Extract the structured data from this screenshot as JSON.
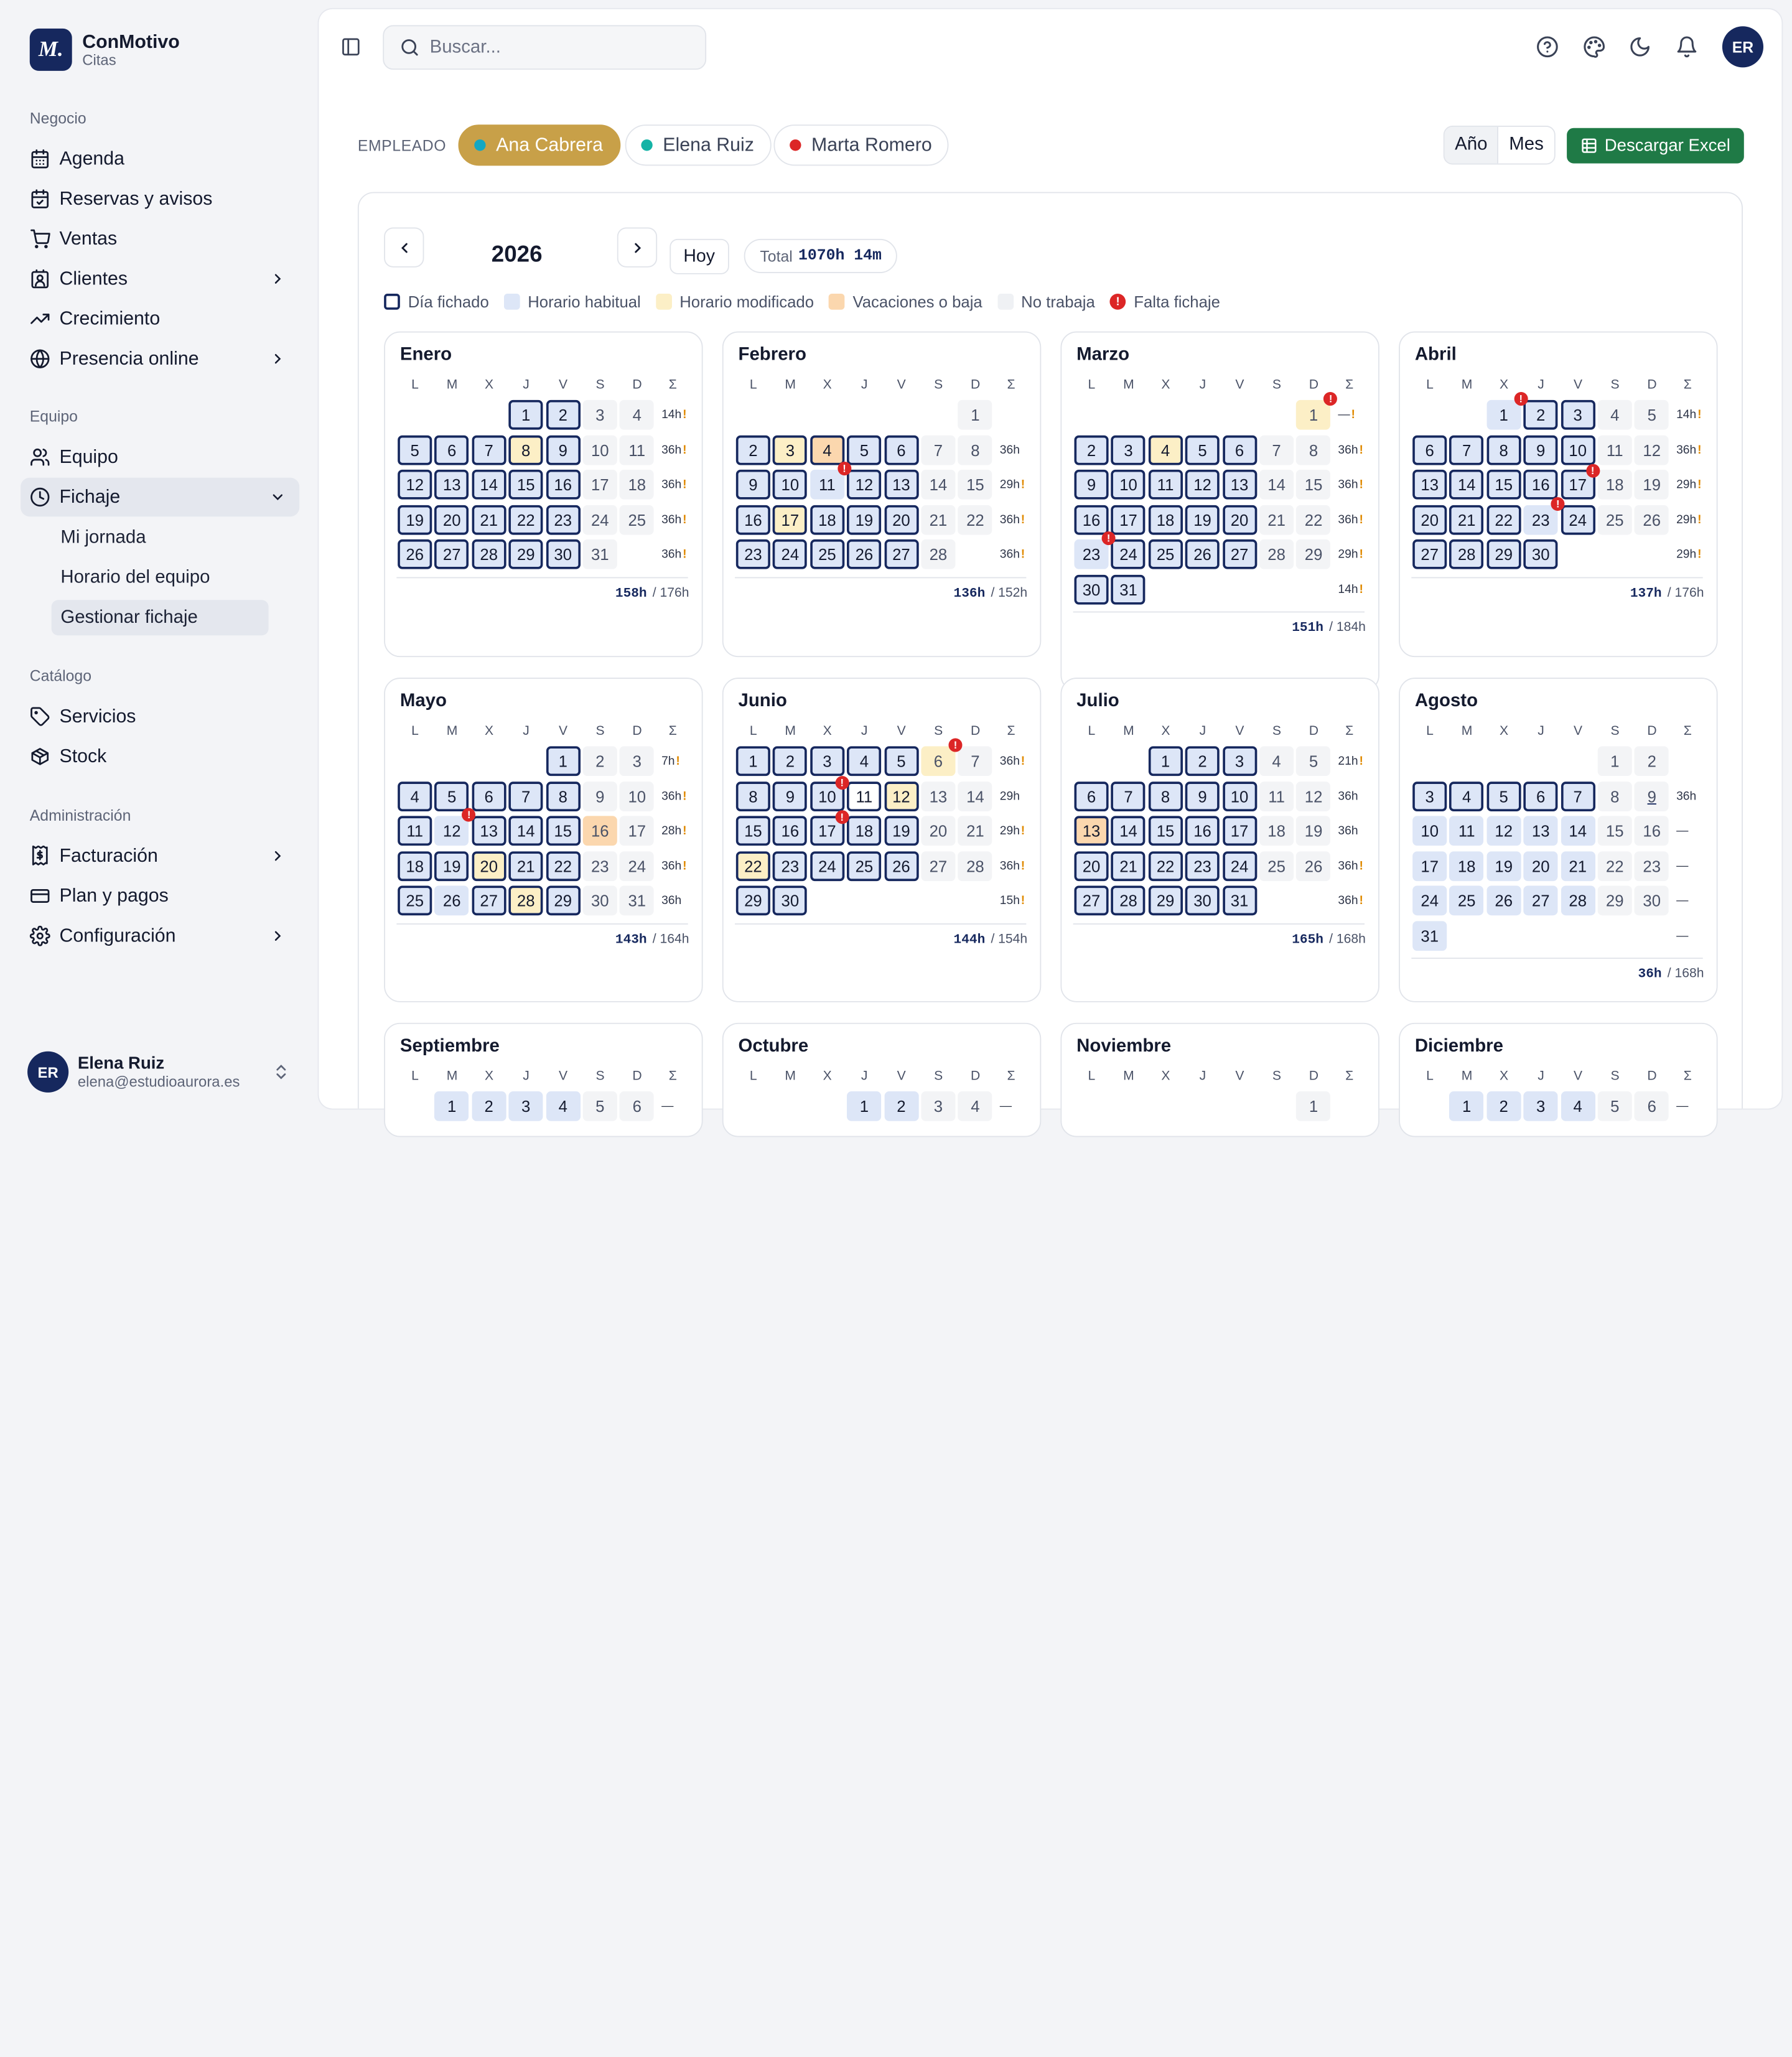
{
  "brand": {
    "name": "ConMotivo",
    "sub": "Citas",
    "logo": "M."
  },
  "sidebar": {
    "sections": {
      "negocio": "Negocio",
      "equipo": "Equipo",
      "catalogo": "Catálogo",
      "admin": "Administración"
    },
    "items": {
      "agenda": "Agenda",
      "reservas": "Reservas y avisos",
      "ventas": "Ventas",
      "clientes": "Clientes",
      "crecimiento": "Crecimiento",
      "presencia": "Presencia online",
      "equipo": "Equipo",
      "fichaje": "Fichaje",
      "servicios": "Servicios",
      "stock": "Stock",
      "facturacion": "Facturación",
      "plan": "Plan y pagos",
      "config": "Configuración"
    },
    "fichaje_sub": {
      "jornada": "Mi jornada",
      "horario": "Horario del equipo",
      "gestionar": "Gestionar fichaje"
    }
  },
  "user": {
    "initials": "ER",
    "name": "Elena Ruiz",
    "email": "elena@estudioaurora.es"
  },
  "topbar": {
    "search_placeholder": "Buscar...",
    "avatar": "ER"
  },
  "employees": {
    "label": "EMPLEADO",
    "list": [
      {
        "name": "Ana Cabrera",
        "color": "#14a7c2"
      },
      {
        "name": "Elena Ruiz",
        "color": "#14b3a6"
      },
      {
        "name": "Marta Romero",
        "color": "#dc2626"
      }
    ]
  },
  "view": {
    "year_label": "Año",
    "month_label": "Mes",
    "excel": "Descargar Excel"
  },
  "calendar": {
    "year": "2026",
    "today": "Hoy",
    "total_label": "Total",
    "total_value": "1070h 14m"
  },
  "legend": {
    "fichado": "Día fichado",
    "habitual": "Horario habitual",
    "modificado": "Horario modificado",
    "vacaciones": "Vacaciones o baja",
    "no_trabaja": "No trabaja",
    "falta": "Falta fichaje"
  },
  "weekdays": [
    "L",
    "M",
    "X",
    "J",
    "V",
    "S",
    "D",
    "Σ"
  ],
  "months": [
    {
      "name": "Enero",
      "offset": 3,
      "days": 31,
      "fichado": [
        1,
        2,
        5,
        6,
        7,
        8,
        9,
        12,
        13,
        14,
        15,
        16,
        19,
        20,
        21,
        22,
        23,
        26,
        27,
        28,
        29,
        30
      ],
      "habitual": [
        1,
        2,
        5,
        6,
        7,
        9,
        12,
        13,
        14,
        15,
        16,
        19,
        20,
        21,
        22,
        23,
        26,
        27,
        28,
        29,
        30
      ],
      "mod": [
        8
      ],
      "vac": [],
      "alerts": [],
      "weeks": [
        "14h!",
        "36h!",
        "36h!",
        "36h!",
        "36h!"
      ],
      "done": "158h",
      "target": "/ 176h"
    },
    {
      "name": "Febrero",
      "offset": 6,
      "days": 28,
      "fichado": [
        2,
        3,
        4,
        5,
        6,
        9,
        10,
        12,
        13,
        16,
        17,
        18,
        19,
        20,
        23,
        24,
        25,
        26,
        27
      ],
      "habitual": [
        2,
        5,
        6,
        9,
        10,
        11,
        12,
        13,
        16,
        18,
        19,
        20,
        23,
        24,
        25,
        26,
        27
      ],
      "mod": [
        3,
        17
      ],
      "vac": [
        4
      ],
      "alerts": [
        11
      ],
      "weeks": [
        "",
        "36h",
        "29h!",
        "36h!",
        "36h!"
      ],
      "done": "136h",
      "target": "/ 152h"
    },
    {
      "name": "Marzo",
      "offset": 6,
      "days": 31,
      "fichado": [
        2,
        3,
        4,
        5,
        6,
        9,
        10,
        11,
        12,
        13,
        16,
        17,
        18,
        19,
        20,
        24,
        25,
        26,
        27,
        30,
        31
      ],
      "habitual": [
        2,
        3,
        5,
        6,
        9,
        10,
        11,
        12,
        13,
        16,
        17,
        18,
        19,
        20,
        23,
        24,
        25,
        26,
        27,
        30,
        31
      ],
      "mod": [
        1,
        4
      ],
      "vac": [],
      "alerts": [
        1,
        23
      ],
      "weeks": [
        "—!",
        "36h!",
        "36h!",
        "36h!",
        "29h!",
        "14h!"
      ],
      "done": "151h",
      "target": "/ 184h"
    },
    {
      "name": "Abril",
      "offset": 2,
      "days": 30,
      "fichado": [
        2,
        3,
        6,
        7,
        8,
        9,
        10,
        13,
        14,
        15,
        16,
        17,
        20,
        21,
        22,
        24,
        27,
        28,
        29,
        30
      ],
      "habitual": [
        1,
        2,
        3,
        6,
        7,
        8,
        9,
        10,
        13,
        14,
        15,
        16,
        17,
        20,
        21,
        22,
        23,
        24,
        27,
        28,
        29,
        30
      ],
      "mod": [],
      "vac": [],
      "alerts": [
        1,
        17,
        23
      ],
      "weeks": [
        "14h!",
        "36h!",
        "29h!",
        "29h!",
        "29h!"
      ],
      "done": "137h",
      "target": "/ 176h"
    },
    {
      "name": "Mayo",
      "offset": 4,
      "days": 31,
      "fichado": [
        1,
        4,
        5,
        6,
        7,
        8,
        11,
        13,
        14,
        15,
        18,
        19,
        20,
        21,
        22,
        25,
        27,
        28,
        29
      ],
      "habitual": [
        1,
        4,
        5,
        6,
        7,
        8,
        11,
        12,
        13,
        14,
        15,
        18,
        19,
        21,
        22,
        25,
        26,
        27,
        29
      ],
      "mod": [
        20,
        28
      ],
      "vac": [
        16
      ],
      "alerts": [
        12
      ],
      "weeks": [
        "7h!",
        "36h!",
        "28h!",
        "36h!",
        "36h"
      ],
      "done": "143h",
      "target": "/ 164h"
    },
    {
      "name": "Junio",
      "offset": 0,
      "days": 30,
      "fichado": [
        1,
        2,
        3,
        4,
        5,
        8,
        9,
        10,
        11,
        12,
        15,
        16,
        17,
        18,
        19,
        22,
        23,
        24,
        25,
        26,
        29,
        30
      ],
      "habitual": [
        1,
        2,
        3,
        4,
        5,
        8,
        9,
        10,
        15,
        16,
        17,
        18,
        19,
        23,
        24,
        25,
        26,
        29,
        30
      ],
      "mod": [
        6,
        12,
        22
      ],
      "vac": [],
      "alerts": [
        6,
        10,
        17
      ],
      "weeks": [
        "36h!",
        "29h",
        "29h!",
        "36h!",
        "15h!"
      ],
      "done": "144h",
      "target": "/ 154h"
    },
    {
      "name": "Julio",
      "offset": 2,
      "days": 31,
      "fichado": [
        1,
        2,
        3,
        6,
        7,
        8,
        9,
        10,
        13,
        14,
        15,
        16,
        17,
        20,
        21,
        22,
        23,
        24,
        27,
        28,
        29,
        30,
        31
      ],
      "habitual": [
        1,
        2,
        3,
        6,
        7,
        8,
        9,
        10,
        14,
        15,
        16,
        17,
        20,
        21,
        22,
        23,
        24,
        27,
        28,
        29,
        30,
        31
      ],
      "mod": [],
      "vac": [
        13
      ],
      "alerts": [],
      "weeks": [
        "21h!",
        "36h",
        "36h",
        "36h!",
        "36h!"
      ],
      "done": "165h",
      "target": "/ 168h"
    },
    {
      "name": "Agosto",
      "offset": 5,
      "days": 31,
      "fichado": [
        3,
        4,
        5,
        6,
        7
      ],
      "habitual": [
        3,
        4,
        5,
        6,
        7,
        10,
        11,
        12,
        13,
        14,
        17,
        18,
        19,
        20,
        21,
        24,
        25,
        26,
        27,
        28,
        31
      ],
      "mod": [],
      "vac": [],
      "alerts": [],
      "today": 9,
      "weeks": [
        "",
        "36h",
        "—",
        "—",
        "—",
        "—"
      ],
      "done": "36h",
      "target": "/ 168h"
    },
    {
      "name": "Septiembre",
      "offset": 1,
      "days": 30,
      "fichado": [],
      "habitual": [
        1,
        2,
        3,
        4
      ],
      "mod": [],
      "vac": [],
      "alerts": [],
      "weeks": [
        "—"
      ],
      "done": "",
      "target": ""
    },
    {
      "name": "Octubre",
      "offset": 3,
      "days": 31,
      "fichado": [],
      "habitual": [
        1,
        2
      ],
      "mod": [],
      "vac": [],
      "alerts": [],
      "weeks": [
        "—"
      ],
      "done": "",
      "target": ""
    },
    {
      "name": "Noviembre",
      "offset": 6,
      "days": 30,
      "fichado": [],
      "habitual": [],
      "mod": [],
      "vac": [],
      "alerts": [],
      "weeks": [
        ""
      ],
      "done": "",
      "target": ""
    },
    {
      "name": "Diciembre",
      "offset": 1,
      "days": 31,
      "fichado": [],
      "habitual": [
        1,
        2,
        3,
        4
      ],
      "mod": [],
      "vac": [],
      "alerts": [],
      "weeks": [
        "—"
      ],
      "done": "",
      "target": ""
    }
  ]
}
